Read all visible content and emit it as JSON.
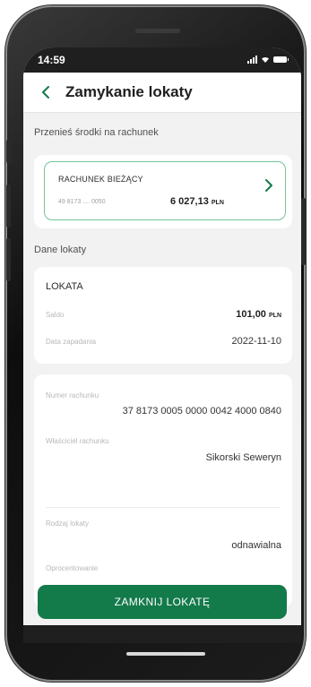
{
  "status_bar": {
    "time": "14:59"
  },
  "header": {
    "title": "Zamykanie lokaty"
  },
  "transfer_section": {
    "title": "Przenieś środki na rachunek"
  },
  "account": {
    "name": "RACHUNEK BIEŻĄCY",
    "number": "49 8173 .... 0050",
    "balance": "6 027,13",
    "currency": "PLN"
  },
  "deposit_section": {
    "title": "Dane lokaty"
  },
  "deposit": {
    "name": "LOKATA",
    "balance_label": "Saldo",
    "balance_value": "101,00",
    "balance_currency": "PLN",
    "maturity_label": "Data zapadania",
    "maturity_value": "2022-11-10"
  },
  "details": {
    "account_number_label": "Numer rachunku",
    "account_number_value": "37 8173 0005 0000 0042 4000 0840",
    "owner_label": "Właściciel rachunku",
    "owner_value": "Sikorski Seweryn",
    "type_label": "Rodzaj lokaty",
    "type_value": "odnawialna",
    "interest_label": "Oprocentowanie"
  },
  "actions": {
    "close_label": "ZAMKNIJ LOKATĘ"
  },
  "colors": {
    "accent": "#137a4a",
    "card_border": "#74c49a",
    "background": "#f2f2f2"
  },
  "icons": {
    "back": "chevron-left-icon",
    "account_arrow": "chevron-right-icon",
    "signal": "signal-icon",
    "wifi": "wifi-icon",
    "battery": "battery-icon"
  }
}
